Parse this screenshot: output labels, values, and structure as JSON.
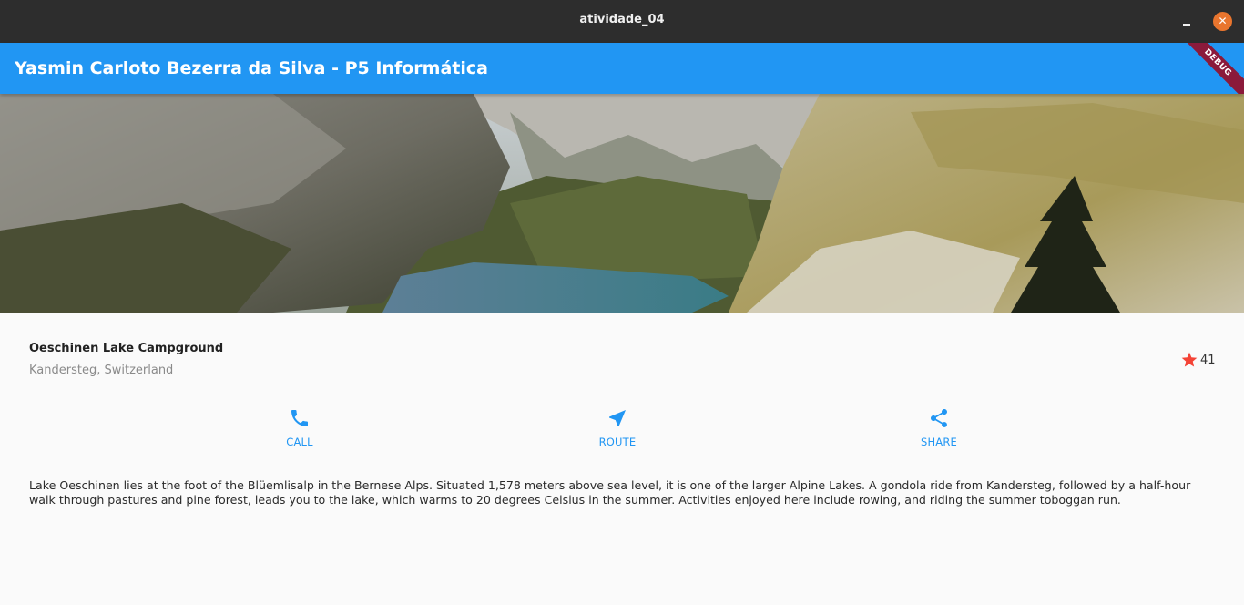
{
  "window": {
    "title": "atividade_04"
  },
  "appbar": {
    "title": "Yasmin Carloto Bezerra da Silva - P5 Informática",
    "debug_banner": "DEBUG"
  },
  "place": {
    "name": "Oeschinen Lake Campground",
    "location": "Kandersteg, Switzerland"
  },
  "rating": {
    "count": "41",
    "icon": "star-icon",
    "color": "#f44336"
  },
  "actions": [
    {
      "label": "CALL",
      "icon": "phone-icon"
    },
    {
      "label": "ROUTE",
      "icon": "navigation-icon"
    },
    {
      "label": "SHARE",
      "icon": "share-icon"
    }
  ],
  "description": "Lake Oeschinen lies at the foot of the Blüemlisalp in the Bernese Alps. Situated 1,578 meters above sea level, it is one of the larger Alpine Lakes. A gondola ride from Kandersteg, followed by a half-hour walk through pastures and pine forest, leads you to the lake, which warms to 20 degrees Celsius in the summer. Activities enjoyed here include rowing, and riding the summer toboggan run.",
  "colors": {
    "primary": "#2196f3",
    "titlebar": "#2d2d2d",
    "close_button": "#e9752e",
    "debug_banner": "#8b1a3b"
  }
}
